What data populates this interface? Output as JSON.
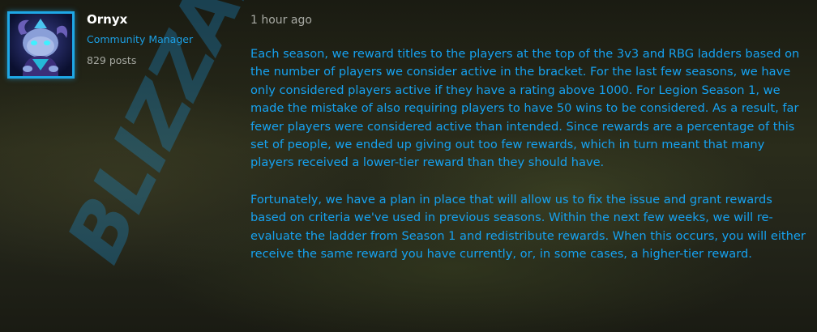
{
  "author": {
    "name": "Ornyx",
    "role": "Community Manager",
    "posts": "829 posts"
  },
  "post": {
    "timestamp": "1 hour ago",
    "paragraphs": [
      "Each season, we reward titles to the players at the top of the 3v3 and RBG ladders based on the number of players we consider active in the bracket. For the last few seasons, we have only considered players active if they have a rating above 1000. For Legion Season 1, we made the mistake of also requiring players to have 50 wins to be considered. As a result, far fewer players were considered active than intended. Since rewards are a percentage of this set of people, we ended up giving out too few rewards, which in turn meant that many players received a lower-tier reward than they should have.",
      "Fortunately, we have a plan in place that will allow us to fix the issue and grant rewards based on criteria we've used in previous seasons. Within the next few weeks, we will re-evaluate the ladder from Season 1 and redistribute rewards. When this occurs, you will either receive the same reward you have currently, or, in some cases, a higher-tier reward."
    ]
  },
  "watermark": {
    "text": "BLIZZARD",
    "color": "#1a8fd0"
  },
  "colors": {
    "accent": "#1ea7e6",
    "body_text": "#16a2f0",
    "muted": "#a8aaa4"
  },
  "icons": {
    "avatar": "avatar-creature-icon"
  }
}
